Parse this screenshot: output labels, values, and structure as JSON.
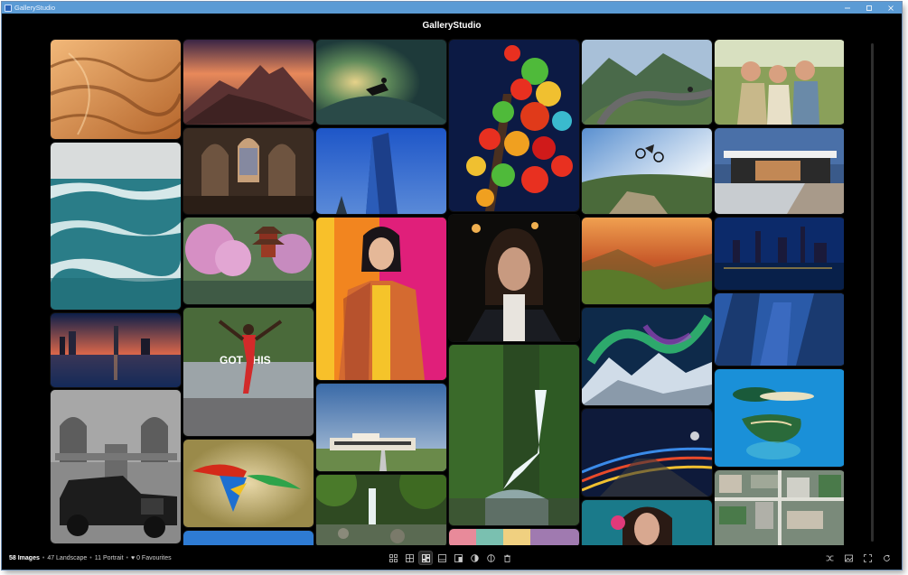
{
  "window": {
    "title": "GalleryStudio"
  },
  "header": {
    "title": "GalleryStudio"
  },
  "status": {
    "count": "58 Images",
    "landscape": "47 Landscape",
    "portrait": "11 Portrait",
    "favourites": "♥ 0 Favourites",
    "separator": "•"
  },
  "toolbar": {
    "view_buttons": [
      "grid-compact-icon",
      "grid-icon",
      "masonry-icon",
      "single-icon",
      "split-icon",
      "contrast-icon",
      "compare-icon",
      "trash-icon"
    ],
    "active_view": "masonry-icon",
    "right_buttons": [
      "shuffle-icon",
      "image-icon",
      "fullscreen-icon",
      "refresh-icon"
    ]
  },
  "gallery": {
    "columns": [
      [
        "desert-dunes",
        "ocean-waves",
        "city-skyline-sunset",
        "vintage-car"
      ],
      [
        "mountain-sunset",
        "cathedral-interior",
        "japanese-pagoda",
        "marathon-runner",
        "macaw-flying",
        "sky-blue"
      ],
      [
        "surfer-wave",
        "blue-skyscraper",
        "fashion-portrait",
        "modern-house-field",
        "forest-waterfall-small"
      ],
      [
        "lantern-festival",
        "woman-portrait-dark",
        "jungle-waterfall",
        "colorful-strip"
      ],
      [
        "mountain-road-skater",
        "mountain-biker",
        "green-valley-sunset",
        "aurora-mountains",
        "light-trails-road",
        "portrait-teal"
      ],
      [
        "laughing-children",
        "modern-villa",
        "night-harbor-skyline",
        "glass-towers",
        "tropical-island",
        "aerial-city"
      ]
    ]
  }
}
